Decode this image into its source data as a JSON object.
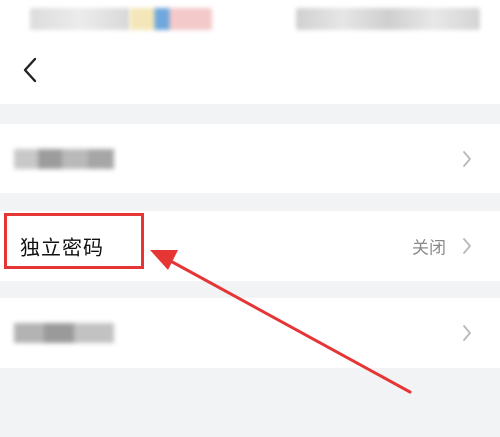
{
  "status_bar": {
    "left_blurred": true,
    "right_blurred": true
  },
  "nav": {
    "back_icon": "chevron-left-icon"
  },
  "rows": [
    {
      "label": "",
      "value": "",
      "obscured": true
    },
    {
      "label": "独立密码",
      "value": "关闭",
      "obscured": false
    },
    {
      "label": "",
      "value": "",
      "obscured": true
    }
  ],
  "annotation": {
    "color": "#e53535"
  }
}
